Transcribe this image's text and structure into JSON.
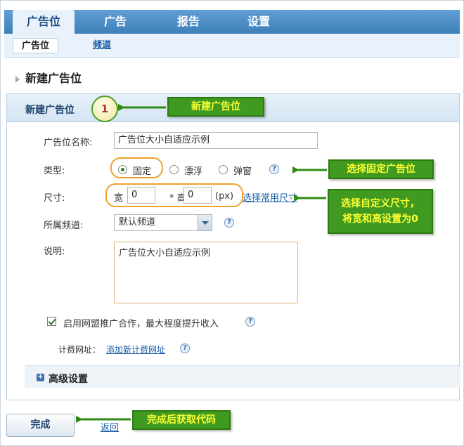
{
  "top_tabs": [
    {
      "label": "广告位",
      "active": true
    },
    {
      "label": "广告",
      "active": false
    },
    {
      "label": "报告",
      "active": false
    },
    {
      "label": "设置",
      "active": false
    }
  ],
  "sub_tabs": [
    {
      "label": "广告位",
      "active": true
    },
    {
      "label": "频道",
      "active": false
    }
  ],
  "page_title": "新建广告位",
  "panel_title": "新建广告位",
  "form": {
    "name_label": "广告位名称:",
    "name_value": "广告位大小自适应示例",
    "type_label": "类型:",
    "type_options": [
      "固定",
      "漂浮",
      "弹窗"
    ],
    "type_selected": "固定",
    "size_label": "尺寸:",
    "width_label": "宽",
    "width_value": "0",
    "height_sep": "* 高",
    "height_value": "0",
    "unit": "(px)",
    "common_size_link": "选择常用尺寸",
    "channel_label": "所属频道:",
    "channel_value": "默认频道",
    "desc_label": "说明:",
    "desc_value": "广告位大小自适应示例",
    "union_checkbox_label": "启用网盟推广合作，最大程度提升收入",
    "billing_label": "计费网址：",
    "billing_link": "添加新计费网址",
    "advanced_label": "高级设置",
    "help_glyph": "?"
  },
  "actions": {
    "done_label": "完成",
    "back_label": "返回"
  },
  "annotations": {
    "step_number": "1",
    "callout_new": "新建广告位",
    "callout_fixed": "选择固定广告位",
    "callout_size_line1": "选择自定义尺寸，",
    "callout_size_line2": "将宽和高设置为0",
    "callout_done": "完成后获取代码"
  },
  "colors": {
    "nav_blue": "#4a8cc6",
    "callout_green": "#3f9a1f",
    "callout_text": "#ffff33",
    "highlight_orange": "#f0a030"
  }
}
